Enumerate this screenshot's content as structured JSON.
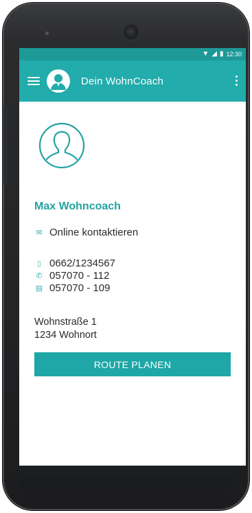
{
  "status": {
    "time": "12:30"
  },
  "app": {
    "title": "Dein WohnCoach"
  },
  "contact": {
    "name": "Max Wohncoach",
    "online_label": "Online kontaktieren",
    "mobile": "0662/1234567",
    "phone": "057070 - 112",
    "fax": "057070 - 109",
    "street": "Wohnstraße 1",
    "city": "1234 Wohnort"
  },
  "actions": {
    "route_label": "ROUTE PLANEN"
  },
  "colors": {
    "accent": "#22acab",
    "status_bar": "#1d9a98",
    "name_color": "#22a3a2"
  },
  "icons": [
    "menu-icon",
    "avatar-icon",
    "more-icon",
    "profile-icon",
    "mail-icon",
    "mobile-icon",
    "phone-icon",
    "fax-icon",
    "wifi-icon",
    "signal-icon",
    "battery-icon"
  ]
}
